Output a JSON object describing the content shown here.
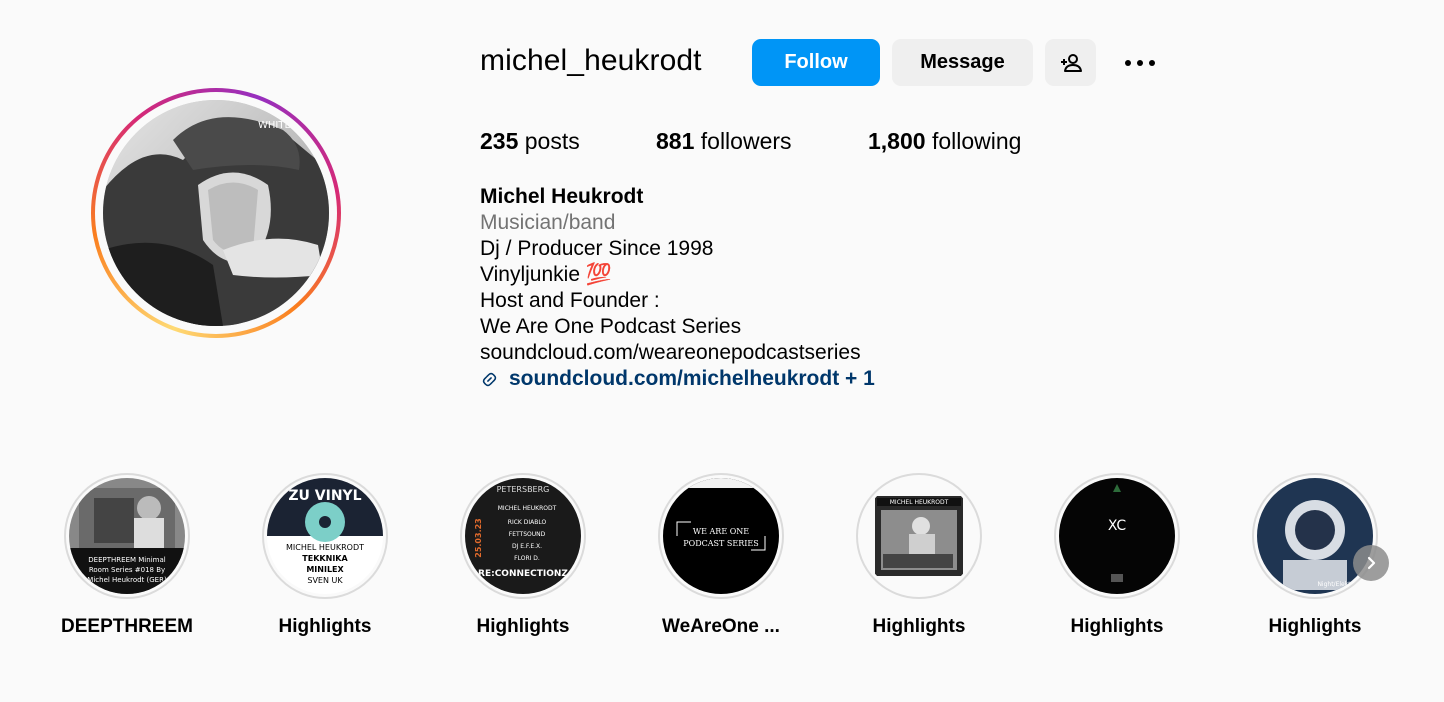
{
  "profile": {
    "username": "michel_heukrodt",
    "follow_label": "Follow",
    "message_label": "Message",
    "avatar_watermark": "WHITE"
  },
  "stats": {
    "posts_count": "235",
    "posts_label": "posts",
    "followers_count": "881",
    "followers_label": "followers",
    "following_count": "1,800",
    "following_label": "following"
  },
  "bio": {
    "name": "Michel Heukrodt",
    "category": "Musician/band",
    "line1": "Dj / Producer Since 1998",
    "line2": "Vinyljunkie 💯",
    "line3": "Host and Founder :",
    "line4": "We Are One Podcast Series",
    "line5": "soundcloud.com/weareonepodcastseries",
    "link": "soundcloud.com/michelheukrodt + 1"
  },
  "highlights": [
    {
      "label": "DEEPTHREEM",
      "cover_text": [
        "DEEPTHREEM Minimal",
        "Room Series #018 By",
        "Michel Heukrodt (GER)"
      ]
    },
    {
      "label": "Highlights",
      "cover_text": [
        "ZU VINYL",
        "MICHEL HEUKRODT",
        "TEKKNIKA",
        "MINILEX",
        "SVEN UK"
      ]
    },
    {
      "label": "Highlights",
      "cover_text": [
        "PETERSBERG",
        "MICHEL HEUKRODT",
        "RICK DIABLO",
        "FETTSOUND",
        "DJ E.F.E.X.",
        "FLORI D.",
        "RE:CONNECTIONZ",
        "25.03.23"
      ]
    },
    {
      "label": "WeAreOne ...",
      "cover_text": [
        "WE ARE ONE",
        "PODCAST SERIES"
      ]
    },
    {
      "label": "Highlights",
      "cover_text": [
        "MICHEL HEUKRODT"
      ]
    },
    {
      "label": "Highlights",
      "cover_text": [
        "XC"
      ]
    },
    {
      "label": "Highlights",
      "cover_text": [
        "Night/Elektro"
      ]
    }
  ],
  "colors": {
    "follow_blue": "#0095f6",
    "link_blue": "#00376b",
    "secondary_gray": "#737373",
    "button_gray": "#efefef"
  },
  "icons": [
    "add-person-icon",
    "more-options-icon",
    "link-icon",
    "chevron-right-icon"
  ]
}
